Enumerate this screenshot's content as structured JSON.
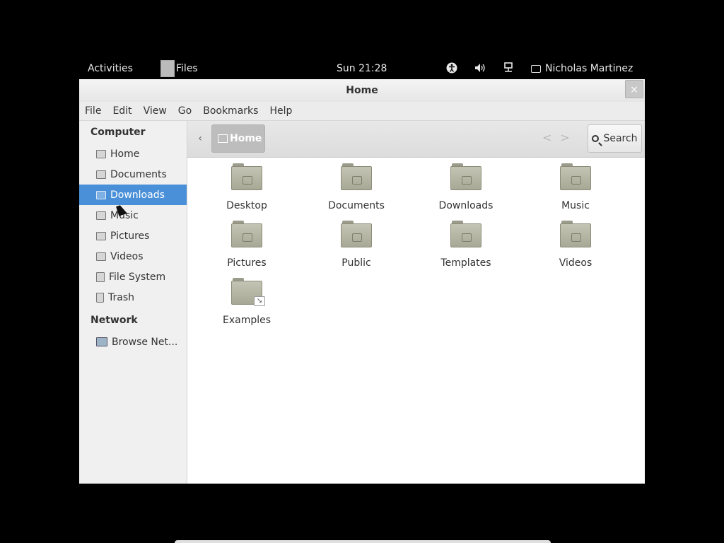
{
  "topbar": {
    "activities": "Activities",
    "app_name": "Files",
    "clock": "Sun 21:28",
    "user": "Nicholas Martinez",
    "icons": [
      "accessibility-icon",
      "volume-icon",
      "network-icon"
    ]
  },
  "window": {
    "title": "Home",
    "close_glyph": "×"
  },
  "menubar": [
    "File",
    "Edit",
    "View",
    "Go",
    "Bookmarks",
    "Help"
  ],
  "sidebar": {
    "computer_header": "Computer",
    "computer_items": [
      {
        "label": "Home",
        "icon": "home-folder-icon"
      },
      {
        "label": "Documents",
        "icon": "documents-folder-icon"
      },
      {
        "label": "Downloads",
        "icon": "downloads-folder-icon",
        "selected": true
      },
      {
        "label": "Music",
        "icon": "music-folder-icon"
      },
      {
        "label": "Pictures",
        "icon": "pictures-folder-icon"
      },
      {
        "label": "Videos",
        "icon": "videos-folder-icon"
      },
      {
        "label": "File System",
        "icon": "drive-icon"
      },
      {
        "label": "Trash",
        "icon": "trash-icon"
      }
    ],
    "network_header": "Network",
    "network_items": [
      {
        "label": "Browse Net...",
        "icon": "network-browse-icon"
      }
    ]
  },
  "toolbar": {
    "back_glyph": "‹",
    "path": "Home",
    "nav_back_glyph": "<",
    "nav_forward_glyph": ">",
    "search_label": "Search"
  },
  "files": [
    {
      "label": "Desktop",
      "icon": "desktop-folder-icon"
    },
    {
      "label": "Documents",
      "icon": "documents-folder-icon"
    },
    {
      "label": "Downloads",
      "icon": "downloads-folder-icon"
    },
    {
      "label": "Music",
      "icon": "music-folder-icon"
    },
    {
      "label": "Pictures",
      "icon": "pictures-folder-icon"
    },
    {
      "label": "Public",
      "icon": "public-folder-icon"
    },
    {
      "label": "Templates",
      "icon": "templates-folder-icon"
    },
    {
      "label": "Videos",
      "icon": "videos-folder-icon"
    },
    {
      "label": "Examples",
      "icon": "examples-link-folder-icon",
      "symlink_glyph": "↘"
    }
  ],
  "colors": {
    "selection": "#4a90d9",
    "folder": "#b4b4a2",
    "sidebar_bg": "#f0f0f0",
    "desktop_bg": "#000000"
  }
}
